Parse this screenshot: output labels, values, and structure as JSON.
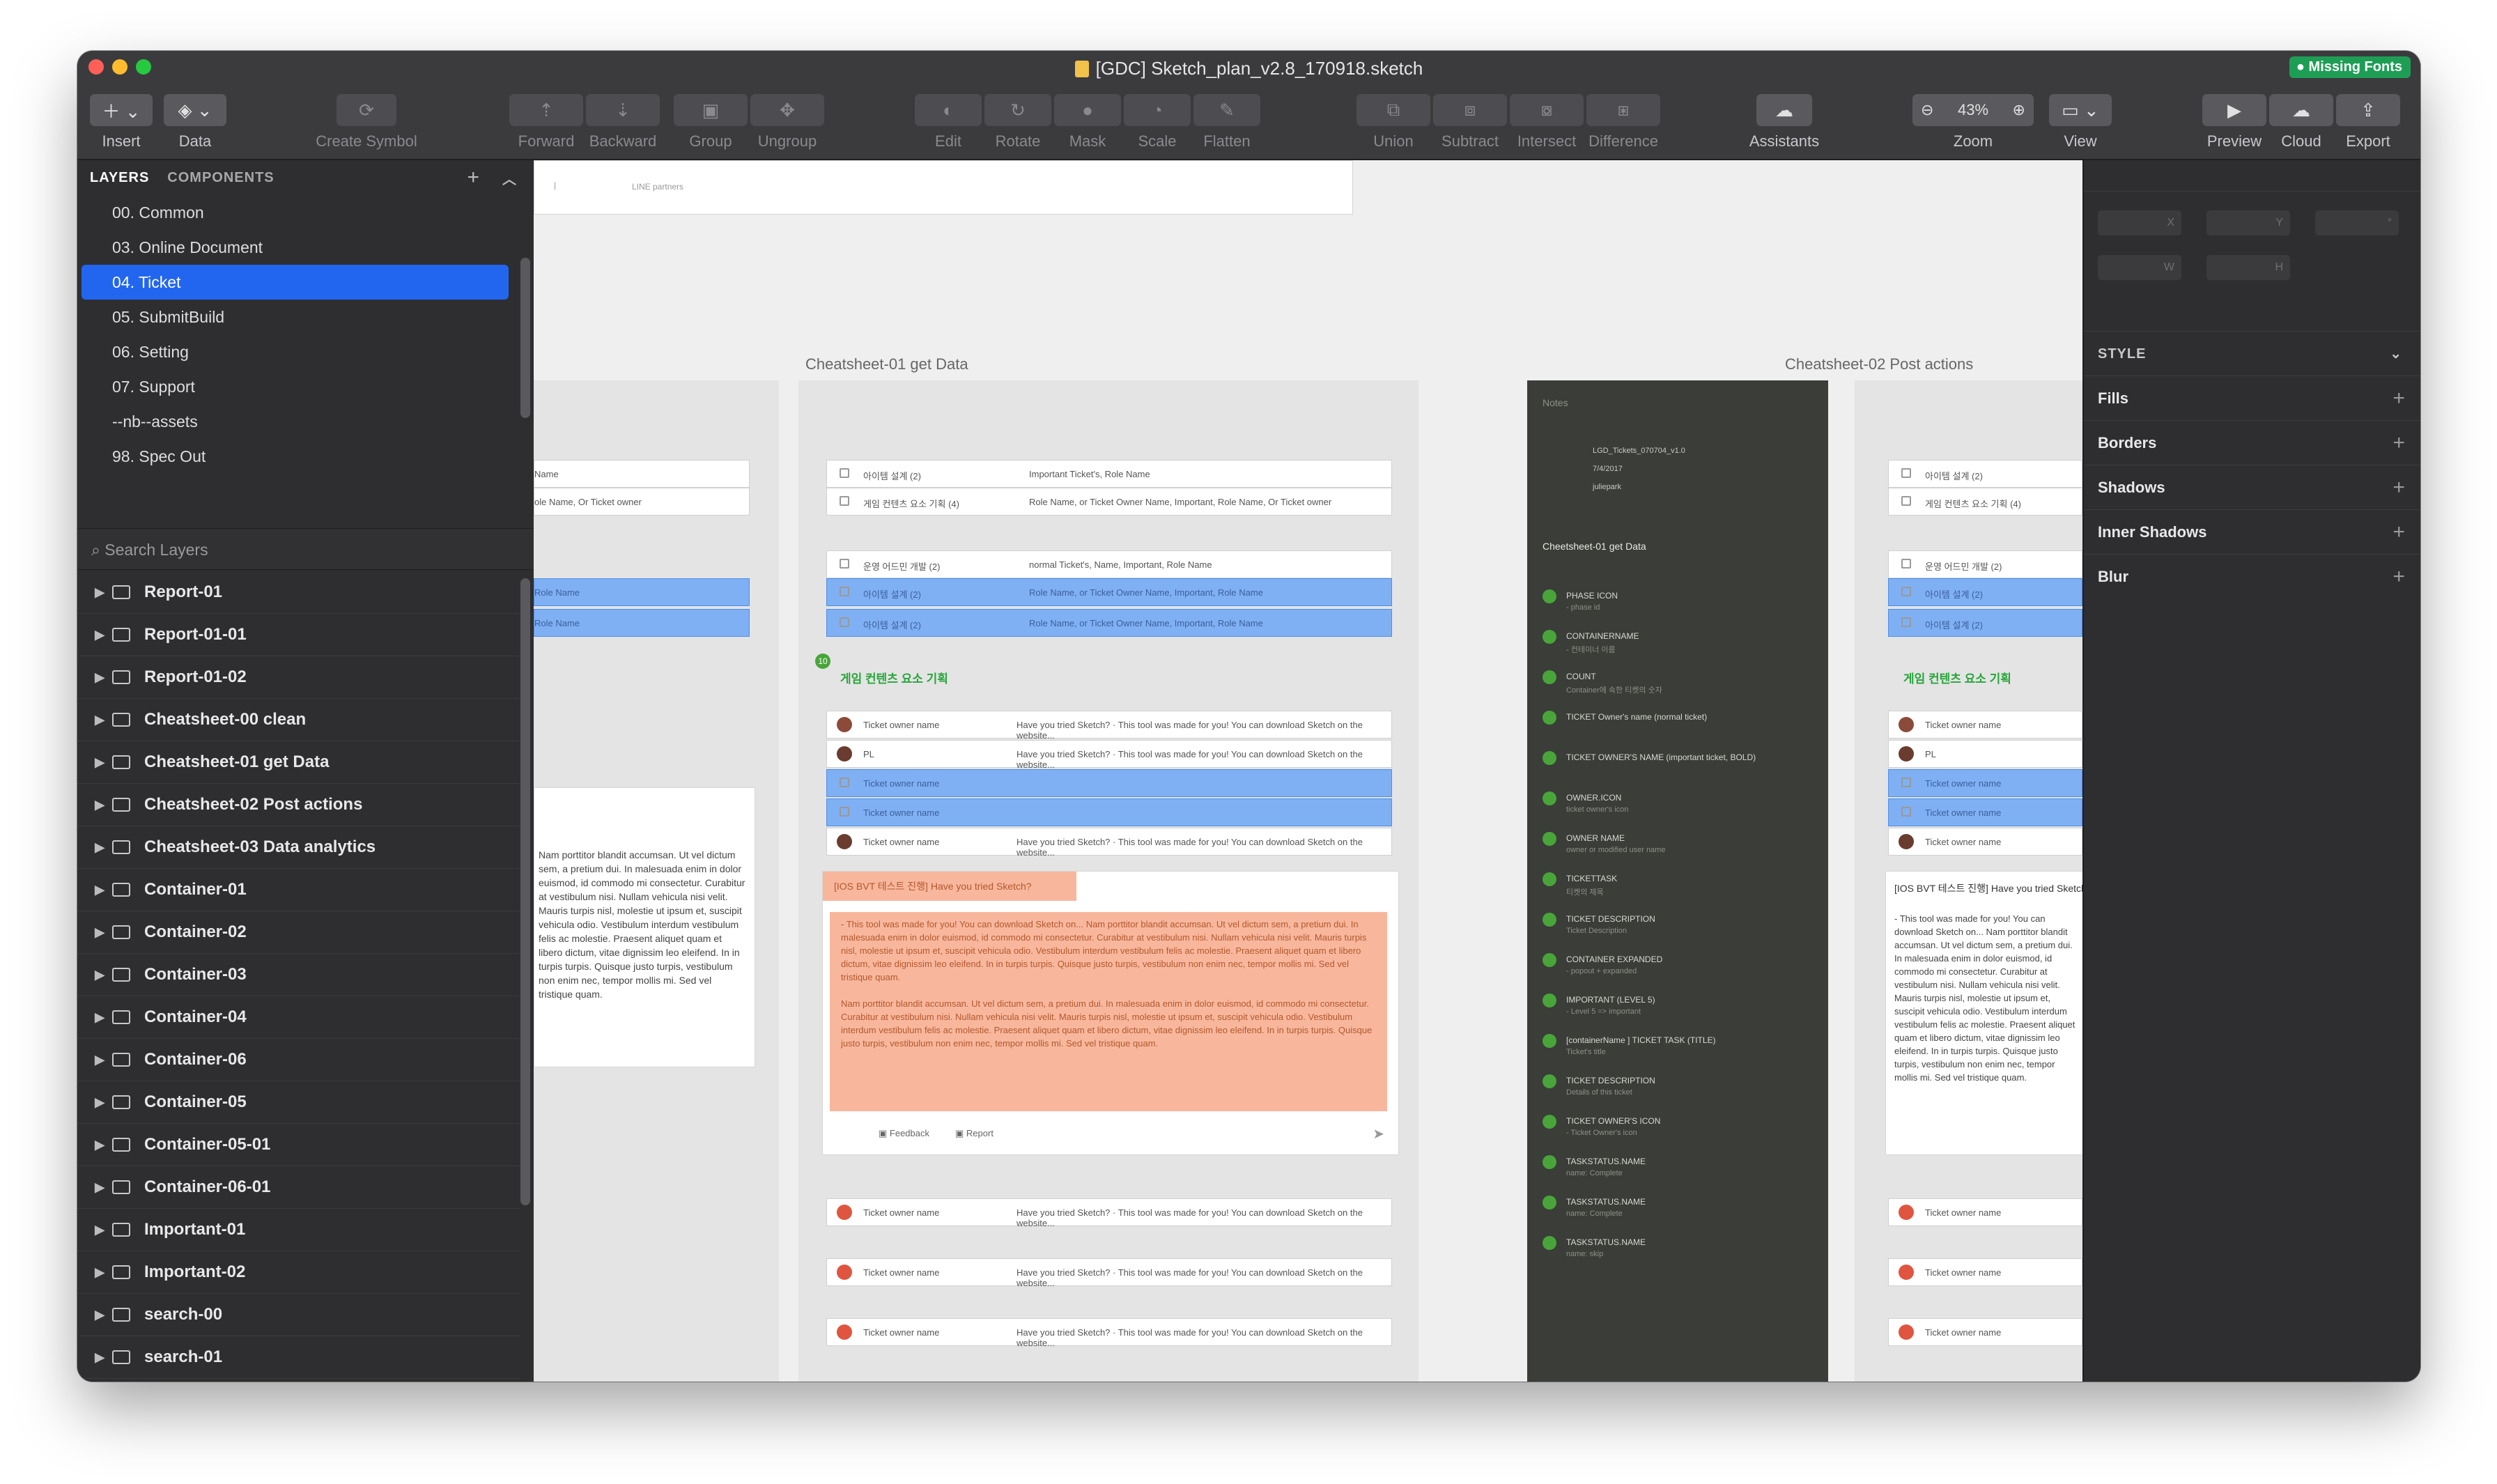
{
  "window": {
    "title": "[GDC] Sketch_plan_v2.8_170918.sketch",
    "missing_fonts": "Missing Fonts"
  },
  "toolbar": {
    "insert": "Insert",
    "data": "Data",
    "create_symbol": "Create Symbol",
    "forward": "Forward",
    "backward": "Backward",
    "group": "Group",
    "ungroup": "Ungroup",
    "edit": "Edit",
    "rotate": "Rotate",
    "mask": "Mask",
    "scale": "Scale",
    "flatten": "Flatten",
    "union": "Union",
    "subtract": "Subtract",
    "intersect": "Intersect",
    "difference": "Difference",
    "assistants": "Assistants",
    "zoom_value": "43%",
    "zoom": "Zoom",
    "view": "View",
    "preview": "Preview",
    "cloud": "Cloud",
    "export": "Export"
  },
  "sidebar": {
    "tab_layers": "LAYERS",
    "tab_components": "COMPONENTS",
    "pages": [
      "00. Common",
      "03. Online Document",
      "04. Ticket",
      "05. SubmitBuild",
      "06. Setting",
      "07. Support",
      "--nb--assets",
      "98. Spec Out"
    ],
    "selected_page": "04. Ticket",
    "search_placeholder": "Search Layers",
    "layers": [
      "Report-01",
      "Report-01-01",
      "Report-01-02",
      "Cheatsheet-00 clean",
      "Cheatsheet-01 get Data",
      "Cheatsheet-02 Post actions",
      "Cheatsheet-03 Data analytics",
      "Container-01",
      "Container-02",
      "Container-03",
      "Container-04",
      "Container-06",
      "Container-05",
      "Container-05-01",
      "Container-06-01",
      "Important-01",
      "Important-02",
      "search-00",
      "search-01",
      "search-02",
      "search-03"
    ]
  },
  "canvas": {
    "artboard_1": "Cheatsheet-01 get Data",
    "artboard_2": "Cheatsheet-02 Post actions",
    "line_partners": "LINE partners",
    "notes_title": "Notes",
    "notes_meta": [
      "LGD_Tickets_070704_v1.0",
      "7/4/2017",
      "juliepark"
    ],
    "notes_heading": "Cheetsheet-01 get Data",
    "notes_items": [
      {
        "label": "PHASE ICON",
        "sub": "- phase id"
      },
      {
        "label": "CONTAINERNAME",
        "sub": "- 컨테이너 이름"
      },
      {
        "label": "COUNT",
        "sub": "Container에 속한 티켓의 숫자"
      },
      {
        "label": "TICKET Owner's name (normal ticket)",
        "sub": ""
      },
      {
        "label": "TICKET OWNER'S NAME (important ticket, BOLD)",
        "sub": ""
      },
      {
        "label": "OWNER.ICON",
        "sub": "ticket owner's icon"
      },
      {
        "label": "OWNER NAME",
        "sub": "owner or modified user name"
      },
      {
        "label": "TICKETTASK",
        "sub": "티켓의 제목"
      },
      {
        "label": "TICKET DESCRIPTION",
        "sub": "Ticket Description"
      },
      {
        "label": "CONTAINER EXPANDED",
        "sub": "- popout + expanded"
      },
      {
        "label": "IMPORTANT (LEVEL 5)",
        "sub": "- Level 5 => important"
      },
      {
        "label": "[containerName ] TICKET TASK (TITLE)",
        "sub": "Ticket's title"
      },
      {
        "label": "TICKET DESCRIPTION",
        "sub": "Details of this ticket"
      },
      {
        "label": "TICKET OWNER'S ICON",
        "sub": "- Ticket Owner's icon"
      },
      {
        "label": "TASKSTATUS.NAME",
        "sub": "name: Complete"
      },
      {
        "label": "TASKSTATUS.NAME",
        "sub": "name: Complete"
      },
      {
        "label": "TASKSTATUS.NAME",
        "sub": "name: skip"
      }
    ],
    "row_texts": {
      "r1_a": "아이템 설계 (2)",
      "r1_b": "Important Ticket's, Role Name",
      "r2_a": "게임 컨텐츠 요소 기획 (4)",
      "r2_b": "Role Name, or Ticket Owner Name, Important, Role Name, Or Ticket owner",
      "r3_a": "운영 어드민 개발 (2)",
      "r3_b": "normal Ticket's, Name, Important, Role Name",
      "r4_a": "아이템 설계 (2)",
      "r4_b": "Role Name, or Ticket Owner Name, Important, Role Name",
      "group_title": "게임 컨텐츠 요소 기획",
      "owner": "Ticket owner name",
      "pl": "PL",
      "tried": "Have you tried Sketch?",
      "tried_long": "Have you tried Sketch? · This tool was made for you! You can download Sketch on the website...",
      "bvt_title": "[IOS BVT 테스트 진행] Have you tried Sketch?",
      "lorem_1": "- This tool was made for you! You can download Sketch on... Nam porttitor blandit accumsan. Ut vel dictum sem, a pretium dui. In malesuada enim in dolor euismod, id commodo mi consectetur. Curabitur at vestibulum nisi. Nullam vehicula nisi velit. Mauris turpis nisl, molestie ut ipsum et, suscipit vehicula odio. Vestibulum interdum vestibulum felis ac molestie. Praesent aliquet quam et libero dictum, vitae dignissim leo eleifend. In in turpis turpis. Quisque justo turpis, vestibulum non enim nec, tempor mollis mi. Sed vel tristique quam.",
      "lorem_2": "Nam porttitor blandit accumsan. Ut vel dictum sem, a pretium dui. In malesuada enim in dolor euismod, id commodo mi consectetur. Curabitur at vestibulum nisi. Nullam vehicula nisi velit. Mauris turpis nisl, molestie ut ipsum et, suscipit vehicula odio. Vestibulum interdum vestibulum felis ac molestie. Praesent aliquet quam et libero dictum, vitae dignissim leo eleifend. In in turpis turpis. Quisque justo turpis, vestibulum non enim nec, tempor mollis mi. Sed vel tristique quam.",
      "feedback": "Feedback",
      "report": "Report"
    }
  },
  "inspector": {
    "field_x": "X",
    "field_y": "Y",
    "field_w": "W",
    "field_h": "H",
    "style": "STYLE",
    "fills": "Fills",
    "borders": "Borders",
    "shadows": "Shadows",
    "inner_shadows": "Inner Shadows",
    "blur": "Blur"
  },
  "colors": {
    "accent_blue": "#2266f0",
    "highlight_row": "#7fb0f4",
    "annotation_green": "#49a53a",
    "salmon": "#f8b79d",
    "missing_fonts_badge": "#1e9e55"
  }
}
